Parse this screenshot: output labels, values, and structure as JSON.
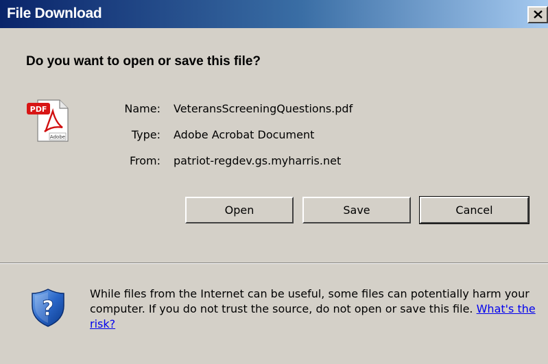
{
  "window": {
    "title": "File Download"
  },
  "dialog": {
    "question": "Do you want to open or save this file?",
    "file": {
      "icon": "pdf-file-icon",
      "icon_badge_top": "PDF",
      "icon_badge_bottom": "Adobe",
      "name_label": "Name:",
      "name_value": "VeteransScreeningQuestions.pdf",
      "type_label": "Type:",
      "type_value": "Adobe Acrobat Document",
      "from_label": "From:",
      "from_value": "patriot-regdev.gs.myharris.net"
    },
    "buttons": {
      "open": "Open",
      "save": "Save",
      "cancel": "Cancel"
    },
    "warning": {
      "icon": "security-shield-question-icon",
      "text": "While files from the Internet can be useful, some files can potentially harm your computer. If you do not trust the source, do not open or save this file.",
      "link_text": "What's the risk?"
    }
  },
  "colors": {
    "title_bar_start": "#0a246a",
    "title_bar_end": "#a6caf0",
    "dialog_background": "#d4d0c8",
    "link": "#0000ee"
  }
}
